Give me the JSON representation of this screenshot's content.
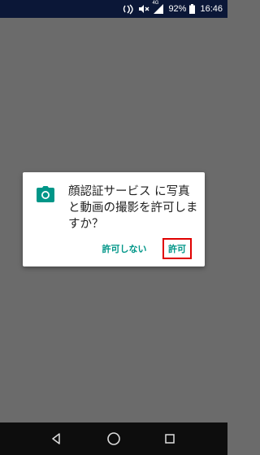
{
  "status_bar": {
    "network": "4G",
    "battery_percent": "92%",
    "time": "16:46"
  },
  "dialog": {
    "icon": "camera-icon",
    "message": "顔認証サービス に写真と動画の撮影を許可しますか？",
    "deny_label": "許可しない",
    "allow_label": "許可",
    "accent_color": "#009688",
    "highlight_color": "#e00000"
  },
  "nav_bar": {
    "back": "back-icon",
    "home": "home-icon",
    "recents": "recents-icon"
  }
}
